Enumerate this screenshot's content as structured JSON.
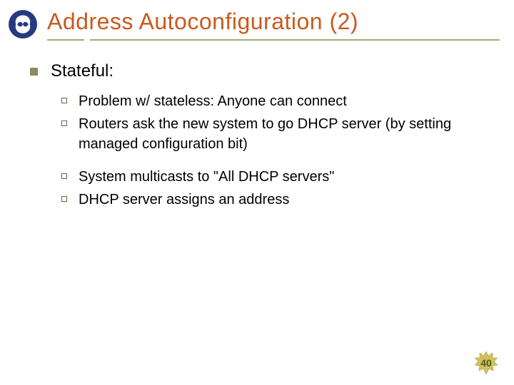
{
  "title": "Address Autoconfiguration (2)",
  "level1": {
    "text": "Stateful:"
  },
  "level2": [
    {
      "text": "Problem w/ stateless: Anyone can connect",
      "gap": false
    },
    {
      "text": "Routers ask the new system to go DHCP server (by setting managed configuration bit)",
      "gap": false
    },
    {
      "text": "System multicasts to \"All DHCP servers\"",
      "gap": true
    },
    {
      "text": "DHCP server assigns an address",
      "gap": false
    }
  ],
  "pageNumber": "40"
}
